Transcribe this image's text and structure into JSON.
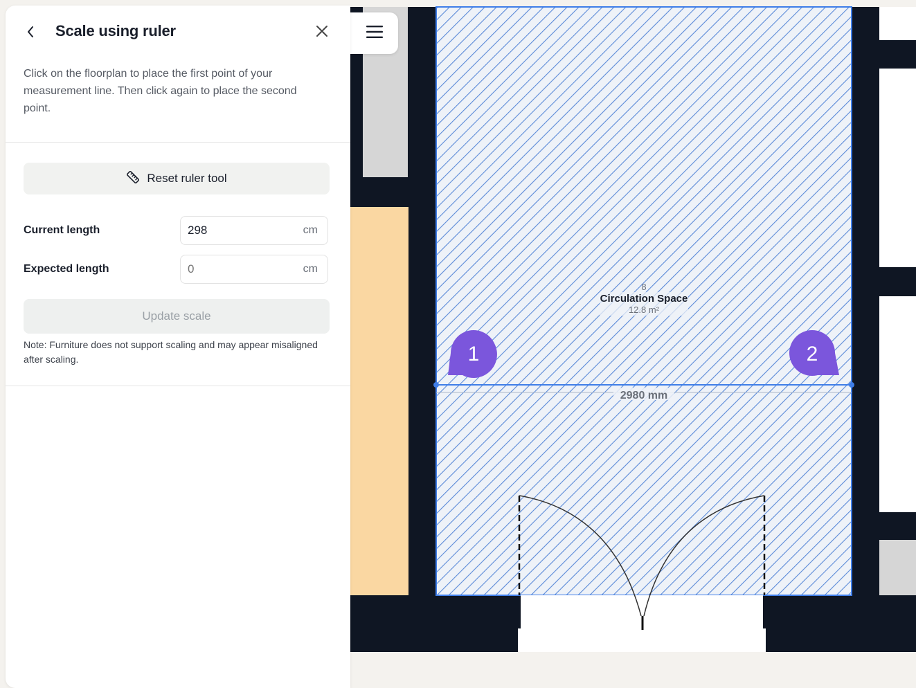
{
  "panel": {
    "title": "Scale using ruler",
    "back_icon": "chevron-left-icon",
    "close_icon": "close-icon",
    "description": "Click on the floorplan to place the first point of your measurement line. Then click again to place the second point.",
    "reset_button": {
      "label": "Reset ruler tool",
      "icon": "ruler-icon"
    },
    "current_length": {
      "label": "Current length",
      "value": "298",
      "unit": "cm"
    },
    "expected_length": {
      "label": "Expected length",
      "value": "0",
      "unit": "cm"
    },
    "update_button": {
      "label": "Update scale",
      "disabled": true
    },
    "note": "Note: Furniture does not support scaling and may appear misaligned after scaling."
  },
  "toolbar": {
    "menu_icon": "hamburger-menu-icon"
  },
  "floorplan": {
    "room": {
      "number": "8",
      "name": "Circulation Space",
      "area": "12.8 m²"
    },
    "measurement": {
      "label": "2980 mm",
      "point1_label": "1",
      "point2_label": "2"
    },
    "colors": {
      "wall": "#0f1623",
      "hatch": "#5b8ad8",
      "hatch_bg": "#eef2f8",
      "selection": "#3f7ee8",
      "marker": "#7b56dc",
      "orange_room": "#fad7a2",
      "grey_room": "#d6d6d6",
      "background": "#f4f2ee"
    }
  }
}
